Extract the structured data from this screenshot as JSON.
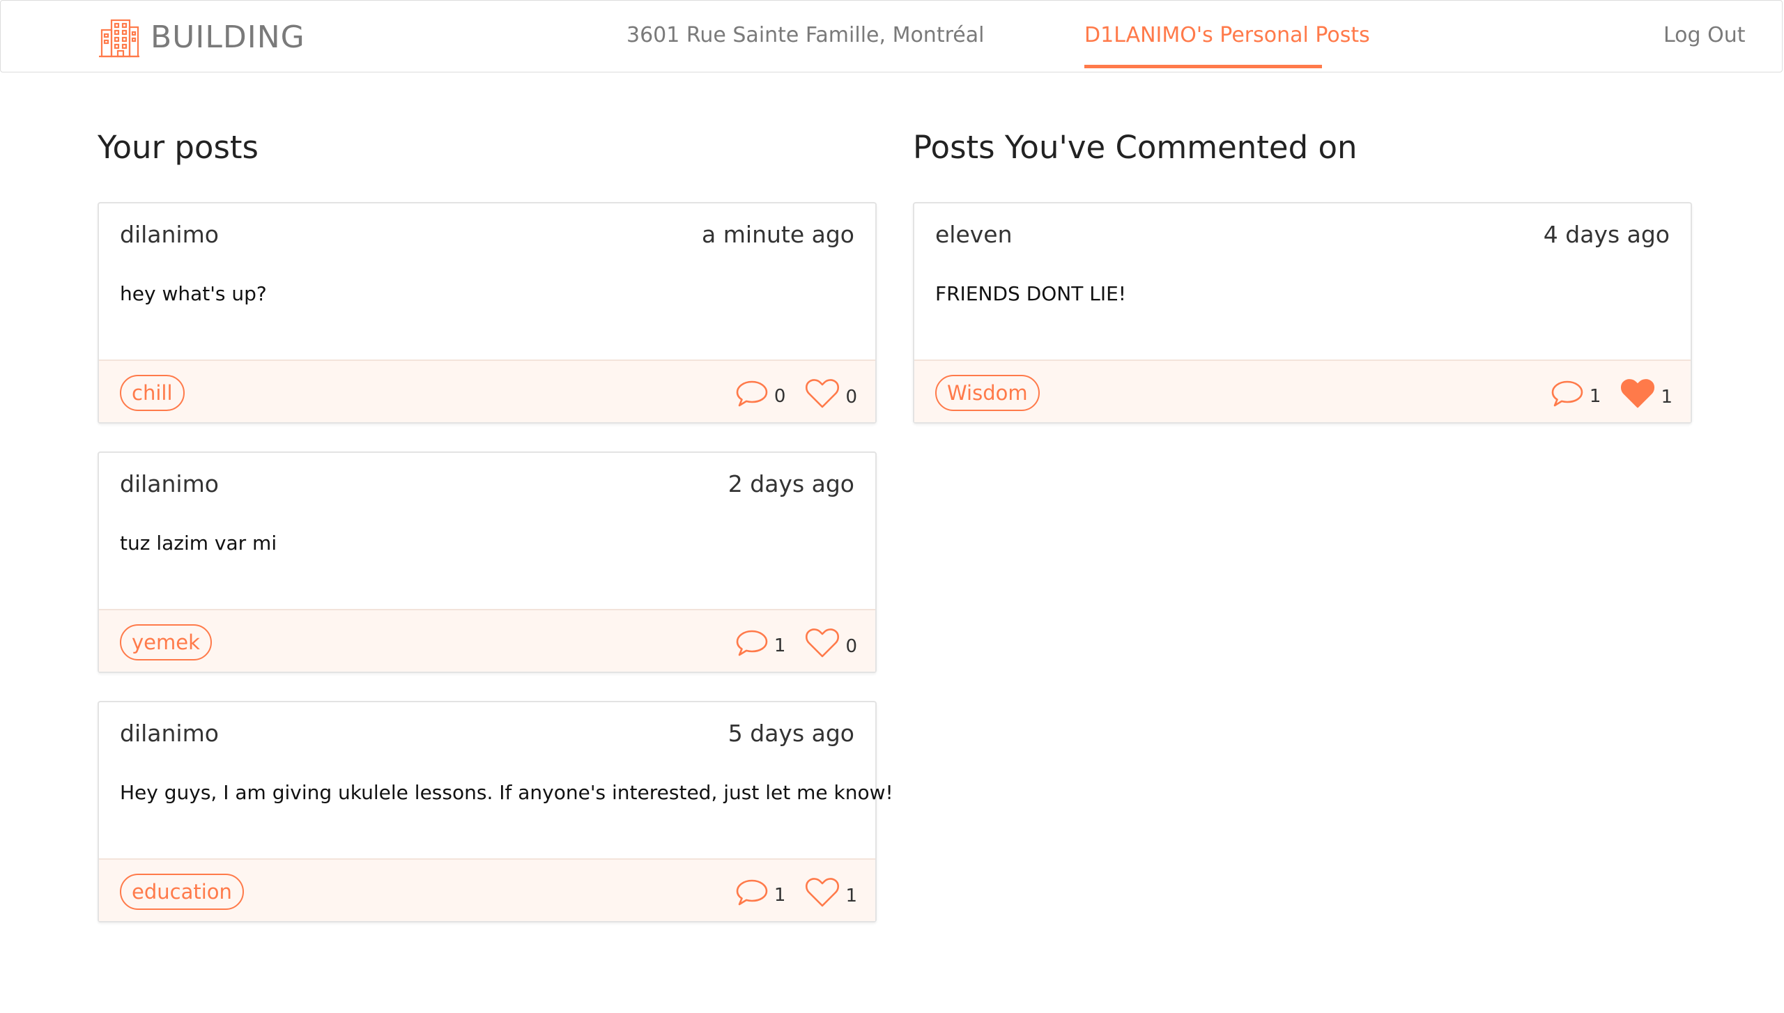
{
  "colors": {
    "accent": "#ff7a4a",
    "nav_text": "#7a7a7a",
    "footer_bg": "#fff6f1",
    "text": "#222222"
  },
  "nav": {
    "brand": "BUILDING",
    "brand_icon": "building-icon",
    "address": "3601 Rue Sainte Famille, Montréal",
    "personal_posts": "D1LANIMO's Personal Posts",
    "logout": "Log Out",
    "active_item": "personal_posts"
  },
  "your_posts": {
    "title": "Your posts",
    "posts": [
      {
        "author": "dilanimo",
        "time": "a minute ago",
        "body": "hey what's up?",
        "tag": "chill",
        "comments": "0",
        "likes": "0",
        "liked": false
      },
      {
        "author": "dilanimo",
        "time": "2 days ago",
        "body": "tuz lazim var mi",
        "tag": "yemek",
        "comments": "1",
        "likes": "0",
        "liked": false
      },
      {
        "author": "dilanimo",
        "time": "5 days ago",
        "body": "Hey guys, I am giving ukulele lessons. If anyone's interested, just let me know!",
        "tag": "education",
        "comments": "1",
        "likes": "1",
        "liked": false
      }
    ]
  },
  "commented_posts": {
    "title": "Posts You've Commented on",
    "posts": [
      {
        "author": "eleven",
        "time": "4 days ago",
        "body": "FRIENDS DONT LIE!",
        "tag": "Wisdom",
        "comments": "1",
        "likes": "1",
        "liked": true
      }
    ]
  },
  "icons": {
    "comment": "speech-bubble-icon",
    "like": "heart-icon"
  }
}
